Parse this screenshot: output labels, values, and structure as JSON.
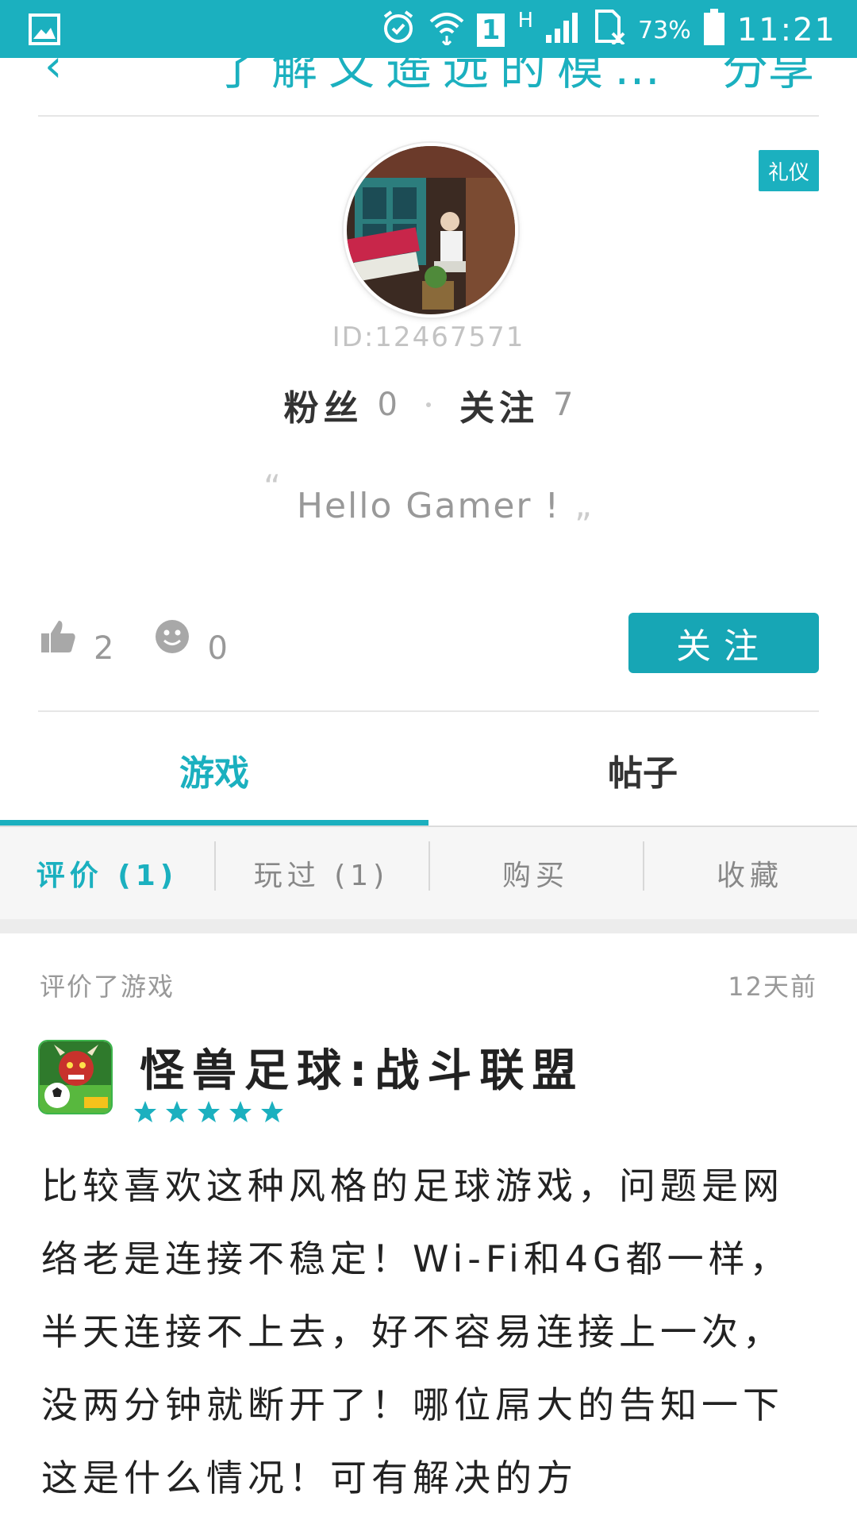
{
  "status_bar": {
    "wifi_sim": "1",
    "network_type": "H",
    "battery_percent": "73%",
    "time": "11:21",
    "color": "#1bb0bf"
  },
  "header": {
    "title": "了解又遥远的模…",
    "share_label": "分享"
  },
  "profile": {
    "badge": "礼仪",
    "user_id": "ID:12467571",
    "fans_label": "粉丝",
    "fans_count": "0",
    "following_label": "关注",
    "following_count": "7",
    "signature": "Hello Gamer !",
    "likes_count": "2",
    "emoji_count": "0",
    "follow_button": "关注"
  },
  "tabs": [
    {
      "label": "游戏",
      "active": true
    },
    {
      "label": "帖子",
      "active": false
    }
  ],
  "subtabs": [
    {
      "label": "评价 (1)",
      "active": true
    },
    {
      "label": "玩过 (1)",
      "active": false
    },
    {
      "label": "购买",
      "active": false
    },
    {
      "label": "收藏",
      "active": false
    }
  ],
  "review_item": {
    "action": "评价了游戏",
    "time_ago": "12天前",
    "game_name": "怪兽足球:战斗联盟",
    "rating": 5,
    "rating_max": 5,
    "text": "比较喜欢这种风格的足球游戏，问题是网络老是连接不稳定！Wi-Fi和4G都一样，半天连接不上去，好不容易连接上一次，没两分钟就断开了！哪位屌大的告知一下这是什么情况！可有解决的方"
  },
  "accent_color": "#1bb0bf"
}
